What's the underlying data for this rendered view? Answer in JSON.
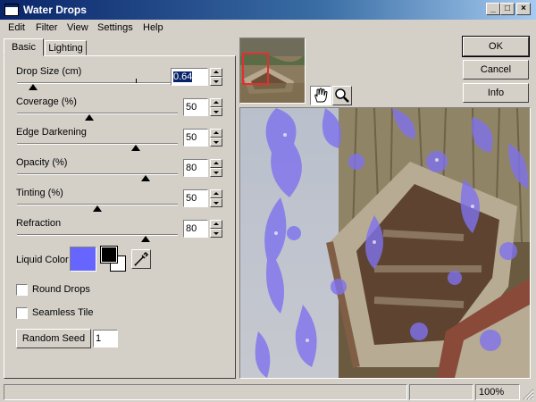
{
  "window": {
    "title": "Water Drops"
  },
  "menu": [
    "Edit",
    "Filter",
    "View",
    "Settings",
    "Help"
  ],
  "tabs": [
    "Basic",
    "Lighting"
  ],
  "params": [
    {
      "label": "Drop Size (cm)",
      "value": "0.64",
      "level": 0.1
    },
    {
      "label": "Coverage (%)",
      "value": "50",
      "level": 0.45
    },
    {
      "label": "Edge Darkening",
      "value": "50",
      "level": 0.74
    },
    {
      "label": "Opacity (%)",
      "value": "80",
      "level": 0.8
    },
    {
      "label": "Tinting (%)",
      "value": "50",
      "level": 0.5
    },
    {
      "label": "Refraction",
      "value": "80",
      "level": 0.8
    }
  ],
  "liquid_color": {
    "label": "Liquid Color",
    "color": "#6666ff",
    "foreground": "#000000",
    "background": "#ffffff"
  },
  "options": {
    "round_drops": "Round Drops",
    "seamless_tile": "Seamless Tile"
  },
  "random_seed": {
    "label": "Random Seed",
    "value": "1"
  },
  "buttons": {
    "ok": "OK",
    "cancel": "Cancel",
    "info": "Info"
  },
  "status": {
    "zoom": "100%"
  }
}
